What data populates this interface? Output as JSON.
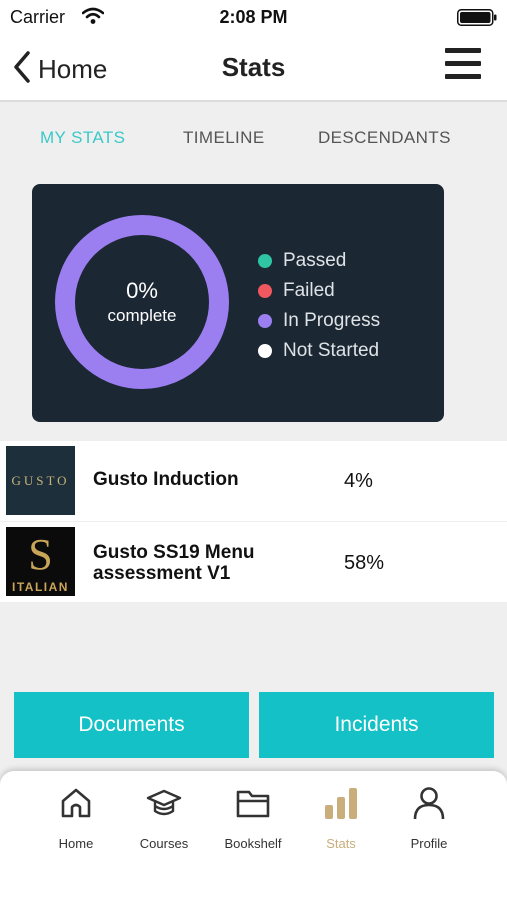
{
  "status_bar": {
    "carrier": "Carrier",
    "time": "2:08 PM"
  },
  "nav": {
    "back_label": "Home",
    "title": "Stats"
  },
  "tabs": [
    {
      "label": "MY STATS",
      "active": true
    },
    {
      "label": "TIMELINE",
      "active": false
    },
    {
      "label": "DESCENDANTS",
      "active": false
    }
  ],
  "stats": {
    "percent": "0%",
    "percent_caption": "complete",
    "ring_color": "#9b7ff0",
    "legend": [
      {
        "label": "Passed",
        "color": "#2ec4a4"
      },
      {
        "label": "Failed",
        "color": "#f0585f"
      },
      {
        "label": "In Progress",
        "color": "#9b7ff0"
      },
      {
        "label": "Not Started",
        "color": "#ffffff"
      }
    ]
  },
  "courses": [
    {
      "thumb_text": "GUSTO",
      "title": "Gusto Induction",
      "progress": "4%"
    },
    {
      "thumb_letter": "S",
      "thumb_text": "ITALIAN",
      "title": "Gusto SS19 Menu assessment V1",
      "progress": "58%"
    }
  ],
  "actions": {
    "documents": "Documents",
    "incidents": "Incidents"
  },
  "tab_bar": [
    {
      "label": "Home",
      "icon": "home-icon",
      "active": false
    },
    {
      "label": "Courses",
      "icon": "graduation-cap-icon",
      "active": false
    },
    {
      "label": "Bookshelf",
      "icon": "folder-icon",
      "active": false
    },
    {
      "label": "Stats",
      "icon": "bar-chart-icon",
      "active": true
    },
    {
      "label": "Profile",
      "icon": "profile-icon",
      "active": false
    }
  ],
  "colors": {
    "accent": "#13c1c6",
    "active_tab_text": "#3cc8c8",
    "card_bg": "#1b2733",
    "tab_active": "#c9ae7c"
  }
}
